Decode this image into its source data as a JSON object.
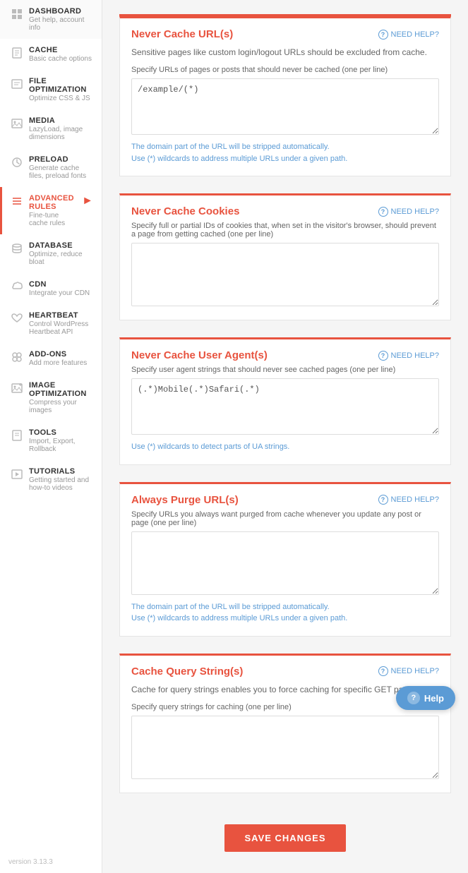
{
  "sidebar": {
    "items": [
      {
        "id": "dashboard",
        "title": "DASHBOARD",
        "subtitle": "Get help, account info",
        "icon": "🏠",
        "active": false
      },
      {
        "id": "cache",
        "title": "CACHE",
        "subtitle": "Basic cache options",
        "icon": "📄",
        "active": false
      },
      {
        "id": "file-optimization",
        "title": "FILE OPTIMIZATION",
        "subtitle": "Optimize CSS & JS",
        "icon": "✉",
        "active": false
      },
      {
        "id": "media",
        "title": "MEDIA",
        "subtitle": "LazyLoad, image dimensions",
        "icon": "🖼",
        "active": false
      },
      {
        "id": "preload",
        "title": "PRELOAD",
        "subtitle": "Generate cache files, preload fonts",
        "icon": "⟳",
        "active": false
      },
      {
        "id": "advanced-rules",
        "title": "ADVANCED RULES",
        "subtitle": "Fine-tune cache rules",
        "icon": "≡",
        "active": true
      },
      {
        "id": "database",
        "title": "DATABASE",
        "subtitle": "Optimize, reduce bloat",
        "icon": "🗄",
        "active": false
      },
      {
        "id": "cdn",
        "title": "CDN",
        "subtitle": "Integrate your CDN",
        "icon": "☁",
        "active": false
      },
      {
        "id": "heartbeat",
        "title": "HEARTBEAT",
        "subtitle": "Control WordPress Heartbeat API",
        "icon": "♥",
        "active": false
      },
      {
        "id": "add-ons",
        "title": "ADD-ONS",
        "subtitle": "Add more features",
        "icon": "👥",
        "active": false
      },
      {
        "id": "image-optimization",
        "title": "IMAGE OPTIMIZATION",
        "subtitle": "Compress your images",
        "icon": "🖼",
        "active": false
      },
      {
        "id": "tools",
        "title": "TOOLS",
        "subtitle": "Import, Export, Rollback",
        "icon": "📄",
        "active": false
      },
      {
        "id": "tutorials",
        "title": "TUTORIALS",
        "subtitle": "Getting started and how-to videos",
        "icon": "▶",
        "active": false
      }
    ],
    "version": "version 3.13.3"
  },
  "sections": [
    {
      "id": "never-cache-urls",
      "title": "Never Cache URL(s)",
      "desc": "Sensitive pages like custom login/logout URLs should be excluded from cache.",
      "field_label": "Specify URLs of pages or posts that should never be cached (one per line)",
      "textarea_value": "/example/(*)",
      "textarea_placeholder": "",
      "hint": "The domain part of the URL will be stripped automatically.\nUse (*) wildcards to address multiple URLs under a given path.",
      "need_help": "NEED HELP?"
    },
    {
      "id": "never-cache-cookies",
      "title": "Never Cache Cookies",
      "desc": "",
      "field_label": "Specify full or partial IDs of cookies that, when set in the visitor's browser, should prevent a page from getting cached (one per line)",
      "textarea_value": "",
      "textarea_placeholder": "",
      "hint": "",
      "need_help": "NEED HELP?"
    },
    {
      "id": "never-cache-user-agent",
      "title": "Never Cache User Agent(s)",
      "desc": "",
      "field_label": "Specify user agent strings that should never see cached pages (one per line)",
      "textarea_value": "(.*)Mobile(.*)Safari(.*)",
      "textarea_placeholder": "",
      "hint": "Use (*) wildcards to detect parts of UA strings.",
      "need_help": "NEED HELP?"
    },
    {
      "id": "always-purge-urls",
      "title": "Always Purge URL(s)",
      "desc": "",
      "field_label": "Specify URLs you always want purged from cache whenever you update any post or page (one per line)",
      "textarea_value": "",
      "textarea_placeholder": "",
      "hint": "The domain part of the URL will be stripped automatically.\nUse (*) wildcards to address multiple URLs under a given path.",
      "need_help": "NEED HELP?"
    },
    {
      "id": "cache-query-strings",
      "title": "Cache Query String(s)",
      "desc": "Cache for query strings enables you to force caching for specific GET parameters.",
      "field_label": "Specify query strings for caching (one per line)",
      "textarea_value": "",
      "textarea_placeholder": "",
      "hint": "",
      "need_help": "NEED HELP?"
    }
  ],
  "save_button": "SAVE CHANGES",
  "help_button": "Help"
}
